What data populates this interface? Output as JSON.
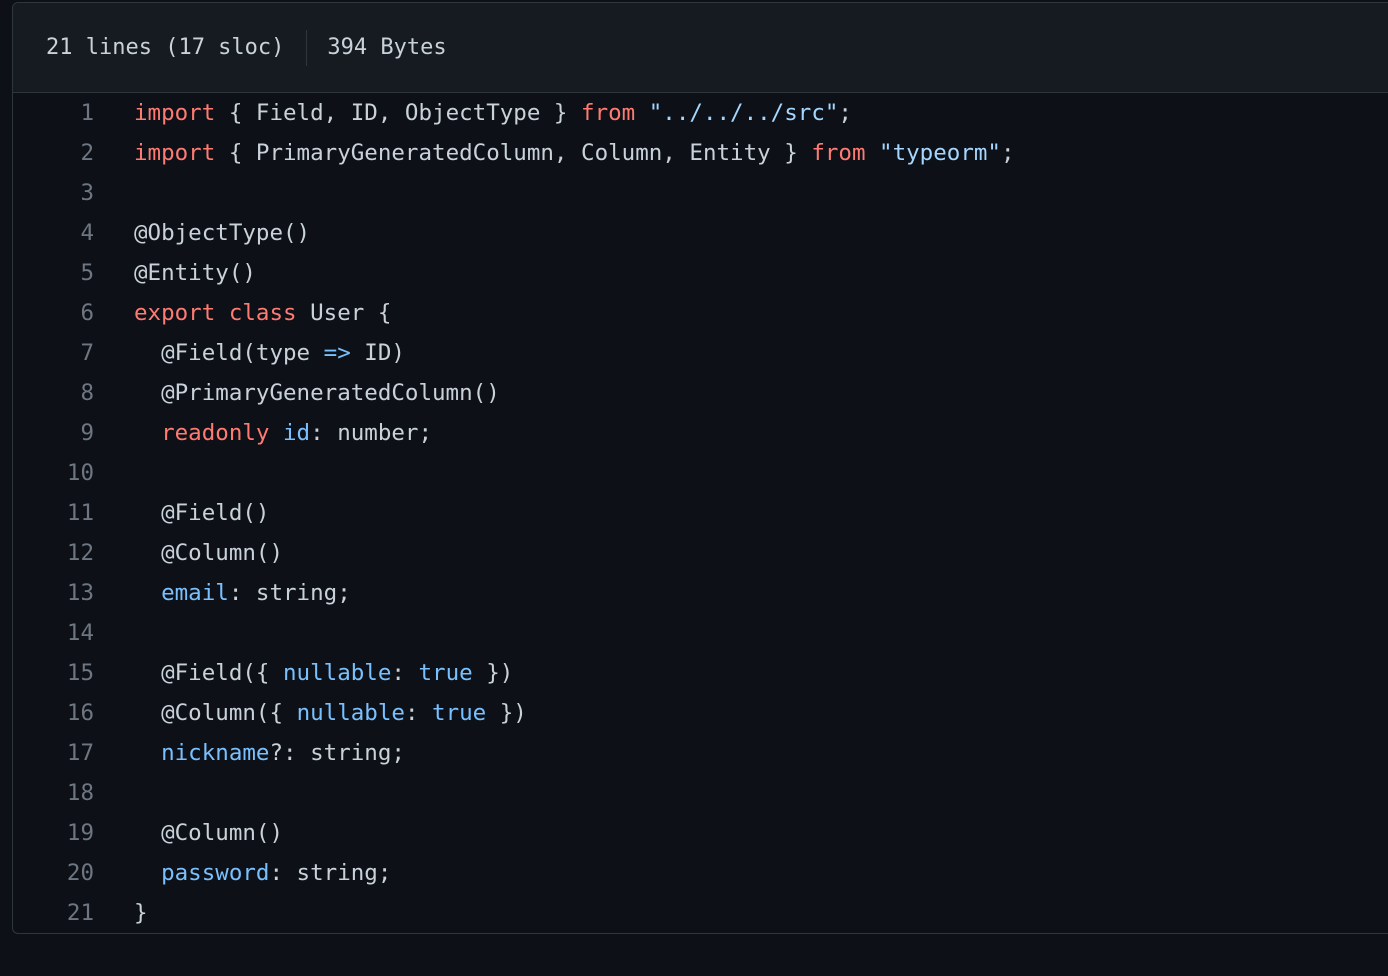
{
  "file_info": {
    "lines": "21 lines (17 sloc)",
    "size": "394 Bytes"
  },
  "colors": {
    "background": "#0d1117",
    "header_bg": "#161b22",
    "keyword": "#ff7b72",
    "string": "#a5d6ff",
    "property": "#79c0ff",
    "text": "#c9d1d9",
    "line_number": "#6e7681"
  },
  "code_lines": [
    {
      "num": "1",
      "tokens": [
        {
          "t": "import",
          "c": "keyword"
        },
        {
          "t": " { Field, ID, ObjectType } ",
          "c": "plain"
        },
        {
          "t": "from",
          "c": "keyword"
        },
        {
          "t": " ",
          "c": "plain"
        },
        {
          "t": "\"../../../src\"",
          "c": "string"
        },
        {
          "t": ";",
          "c": "plain"
        }
      ]
    },
    {
      "num": "2",
      "tokens": [
        {
          "t": "import",
          "c": "keyword"
        },
        {
          "t": " { PrimaryGeneratedColumn, Column, Entity } ",
          "c": "plain"
        },
        {
          "t": "from",
          "c": "keyword"
        },
        {
          "t": " ",
          "c": "plain"
        },
        {
          "t": "\"typeorm\"",
          "c": "string"
        },
        {
          "t": ";",
          "c": "plain"
        }
      ]
    },
    {
      "num": "3",
      "tokens": []
    },
    {
      "num": "4",
      "tokens": [
        {
          "t": "@ObjectType()",
          "c": "plain"
        }
      ]
    },
    {
      "num": "5",
      "tokens": [
        {
          "t": "@Entity()",
          "c": "plain"
        }
      ]
    },
    {
      "num": "6",
      "tokens": [
        {
          "t": "export",
          "c": "keyword"
        },
        {
          "t": " ",
          "c": "plain"
        },
        {
          "t": "class",
          "c": "keyword"
        },
        {
          "t": " User {",
          "c": "plain"
        }
      ]
    },
    {
      "num": "7",
      "tokens": [
        {
          "t": "  @Field(type ",
          "c": "plain"
        },
        {
          "t": "=>",
          "c": "op"
        },
        {
          "t": " ID)",
          "c": "plain"
        }
      ]
    },
    {
      "num": "8",
      "tokens": [
        {
          "t": "  @PrimaryGeneratedColumn()",
          "c": "plain"
        }
      ]
    },
    {
      "num": "9",
      "tokens": [
        {
          "t": "  ",
          "c": "plain"
        },
        {
          "t": "readonly",
          "c": "keyword"
        },
        {
          "t": " ",
          "c": "plain"
        },
        {
          "t": "id",
          "c": "prop"
        },
        {
          "t": ": number;",
          "c": "plain"
        }
      ]
    },
    {
      "num": "10",
      "tokens": []
    },
    {
      "num": "11",
      "tokens": [
        {
          "t": "  @Field()",
          "c": "plain"
        }
      ]
    },
    {
      "num": "12",
      "tokens": [
        {
          "t": "  @Column()",
          "c": "plain"
        }
      ]
    },
    {
      "num": "13",
      "tokens": [
        {
          "t": "  ",
          "c": "plain"
        },
        {
          "t": "email",
          "c": "prop"
        },
        {
          "t": ": string;",
          "c": "plain"
        }
      ]
    },
    {
      "num": "14",
      "tokens": []
    },
    {
      "num": "15",
      "tokens": [
        {
          "t": "  @Field({ ",
          "c": "plain"
        },
        {
          "t": "nullable",
          "c": "prop"
        },
        {
          "t": ": ",
          "c": "plain"
        },
        {
          "t": "true",
          "c": "prop"
        },
        {
          "t": " })",
          "c": "plain"
        }
      ]
    },
    {
      "num": "16",
      "tokens": [
        {
          "t": "  @Column({ ",
          "c": "plain"
        },
        {
          "t": "nullable",
          "c": "prop"
        },
        {
          "t": ": ",
          "c": "plain"
        },
        {
          "t": "true",
          "c": "prop"
        },
        {
          "t": " })",
          "c": "plain"
        }
      ]
    },
    {
      "num": "17",
      "tokens": [
        {
          "t": "  ",
          "c": "plain"
        },
        {
          "t": "nickname",
          "c": "prop"
        },
        {
          "t": "?: string;",
          "c": "plain"
        }
      ]
    },
    {
      "num": "18",
      "tokens": []
    },
    {
      "num": "19",
      "tokens": [
        {
          "t": "  @Column()",
          "c": "plain"
        }
      ]
    },
    {
      "num": "20",
      "tokens": [
        {
          "t": "  ",
          "c": "plain"
        },
        {
          "t": "password",
          "c": "prop"
        },
        {
          "t": ": string;",
          "c": "plain"
        }
      ]
    },
    {
      "num": "21",
      "tokens": [
        {
          "t": "}",
          "c": "plain"
        }
      ]
    }
  ]
}
